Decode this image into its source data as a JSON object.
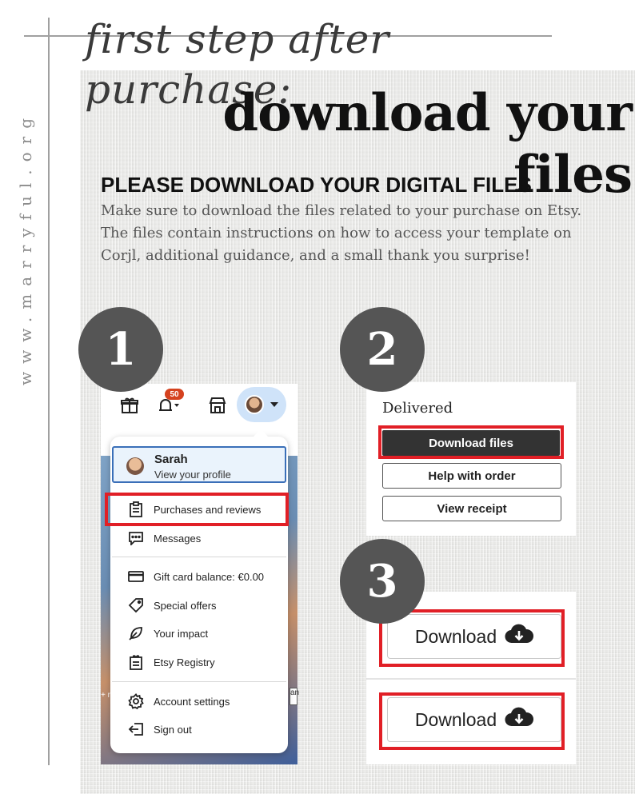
{
  "site_url": "www.marryful.org",
  "script_title": "first step after purchase:",
  "main_title": "download your files",
  "heading": "PLEASE DOWNLOAD YOUR DIGITAL FILES",
  "body": "Make sure to download the files related to your purchase on Etsy. The files contain instructions on how to access your template on Corjl, additional guidance, and a small thank you surprise!",
  "steps": [
    "1",
    "2",
    "3"
  ],
  "etsy_menu": {
    "notification_count": "50",
    "profile_name": "Sarah",
    "profile_sub": "View your profile",
    "items": [
      {
        "label": "Purchases and reviews",
        "icon": "clipboard-icon"
      },
      {
        "label": "Messages",
        "icon": "message-icon"
      },
      {
        "label": "Gift card balance: €0.00",
        "icon": "gift-card-icon"
      },
      {
        "label": "Special offers",
        "icon": "tag-icon"
      },
      {
        "label": "Your impact",
        "icon": "leaf-icon"
      },
      {
        "label": "Etsy Registry",
        "icon": "registry-icon"
      },
      {
        "label": "Account settings",
        "icon": "gear-icon"
      },
      {
        "label": "Sign out",
        "icon": "sign-out-icon"
      }
    ]
  },
  "order_panel": {
    "status": "Delivered",
    "download_files": "Download files",
    "help_with_order": "Help with order",
    "view_receipt": "View receipt"
  },
  "download_panel": {
    "button_label": "Download"
  },
  "colors": {
    "highlight_red": "#e11f26",
    "step_circle": "#555555",
    "etsy_dark_button": "#333333"
  }
}
